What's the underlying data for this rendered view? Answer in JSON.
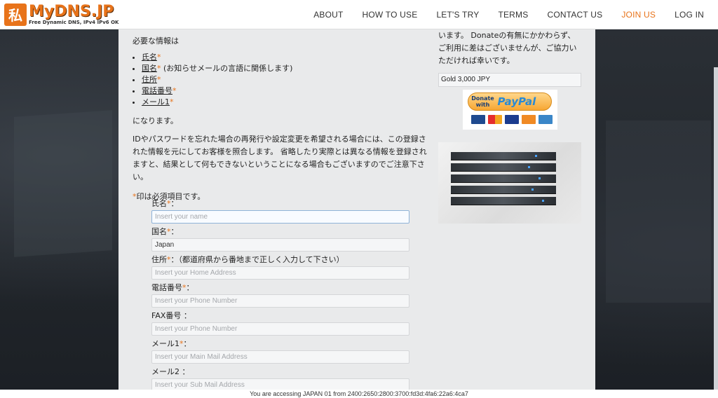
{
  "header": {
    "logo_mark": "私",
    "logo_title": "MyDNS.JP",
    "logo_subtitle": "Free Dynamic DNS, IPv4 IPv6 OK",
    "nav": [
      {
        "label": "ABOUT"
      },
      {
        "label": "HOW TO USE"
      },
      {
        "label": "LET'S TRY"
      },
      {
        "label": "TERMS"
      },
      {
        "label": "CONTACT US"
      },
      {
        "label": "JOIN US",
        "active": true
      },
      {
        "label": "LOG IN"
      }
    ]
  },
  "main": {
    "required_title": "必要な情報は",
    "required_items": [
      {
        "label": "氏名",
        "suffix": ""
      },
      {
        "label": "国名",
        "suffix": " (お知らせメールの言語に関係します)"
      },
      {
        "label": "住所",
        "suffix": ""
      },
      {
        "label": "電話番号",
        "suffix": ""
      },
      {
        "label": "メール1",
        "suffix": ""
      }
    ],
    "required_star": "*",
    "closing": "になります。",
    "paragraph": "IDやパスワードを忘れた場合の再発行や設定変更を希望される場合には、この登録された情報を元にしてお客様を照合します。 省略したり実際とは異なる情報を登録されますと、結果として何もできないということになる場合もございますのでご注意下さい。",
    "mandatory_note": "印は必須項目です。"
  },
  "form": {
    "name_label": "氏名",
    "name_placeholder": "Insert your name",
    "country_label": "国名",
    "country_value": "Japan",
    "address_label": "住所",
    "address_note": "：（都道府県から番地まで正しく入力して下さい）",
    "address_placeholder": "Insert your Home Address",
    "phone_label": "電話番号",
    "phone_placeholder": "Insert your Phone Number",
    "fax_label": "FAX番号 ：",
    "fax_placeholder": "Insert your Phone Number",
    "mail1_label": "メール1",
    "mail1_placeholder": "Insert your Main Mail Address",
    "mail2_label": "メール2 ：",
    "mail2_placeholder": "Insert your Sub Mail Address",
    "colon": "："
  },
  "sidebar": {
    "donate_text": "います。 Donateの有無にかかわらず、ご利用に差はございませんが、ご協力いただければ幸いです。",
    "gold_option": "Gold 3,000 JPY",
    "paypal_donate": "Donate with",
    "paypal_logo_a": "Pay",
    "paypal_logo_b": "Pal",
    "colors": {
      "accent": "#e8731a",
      "paypal_blue": "#1f4a8f"
    }
  },
  "footer": {
    "access_text": "You are accessing JAPAN 01 from 2400:2650:2800:3700:fd3d:4fa6:22a6:4ca7"
  }
}
